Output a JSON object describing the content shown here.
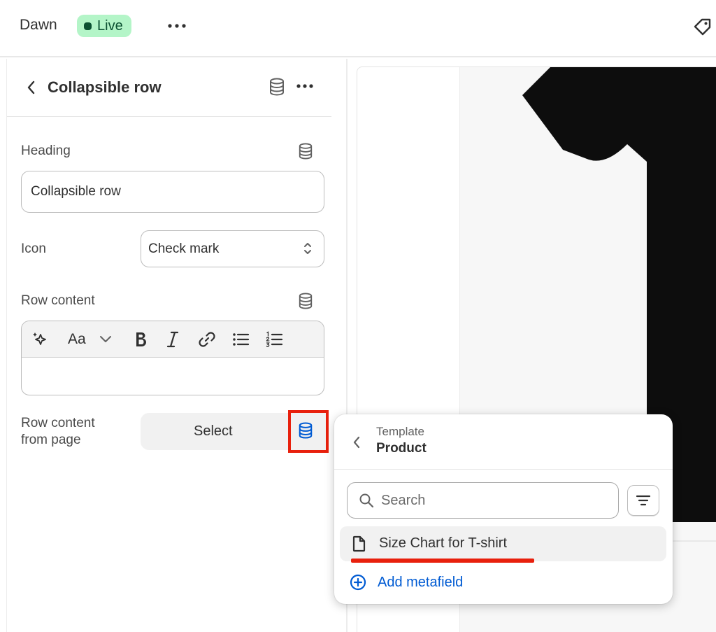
{
  "topbar": {
    "theme_name": "Dawn",
    "status_badge": "Live"
  },
  "panel": {
    "title": "Collapsible row",
    "heading": {
      "label": "Heading",
      "value": "Collapsible row"
    },
    "icon": {
      "label": "Icon",
      "selected": "Check mark"
    },
    "row_content": {
      "label": "Row content",
      "toolbar": [
        "magic",
        "text-style",
        "bold",
        "italic",
        "link",
        "bullet-list",
        "numbered-list"
      ],
      "text_style_label": "Aa",
      "value": ""
    },
    "row_content_from_page": {
      "label_line1": "Row content",
      "label_line2": "from page",
      "button_label": "Select"
    }
  },
  "popover": {
    "subtitle": "Template",
    "title": "Product",
    "search": {
      "placeholder": "Search"
    },
    "items": [
      {
        "label": "Size Chart for T-shirt",
        "icon": "page-icon"
      }
    ],
    "add_label": "Add metafield"
  },
  "colors": {
    "badge_bg": "#b4f5c8",
    "badge_text": "#0c5132",
    "highlight": "#e8200d",
    "link": "#005bd3"
  }
}
